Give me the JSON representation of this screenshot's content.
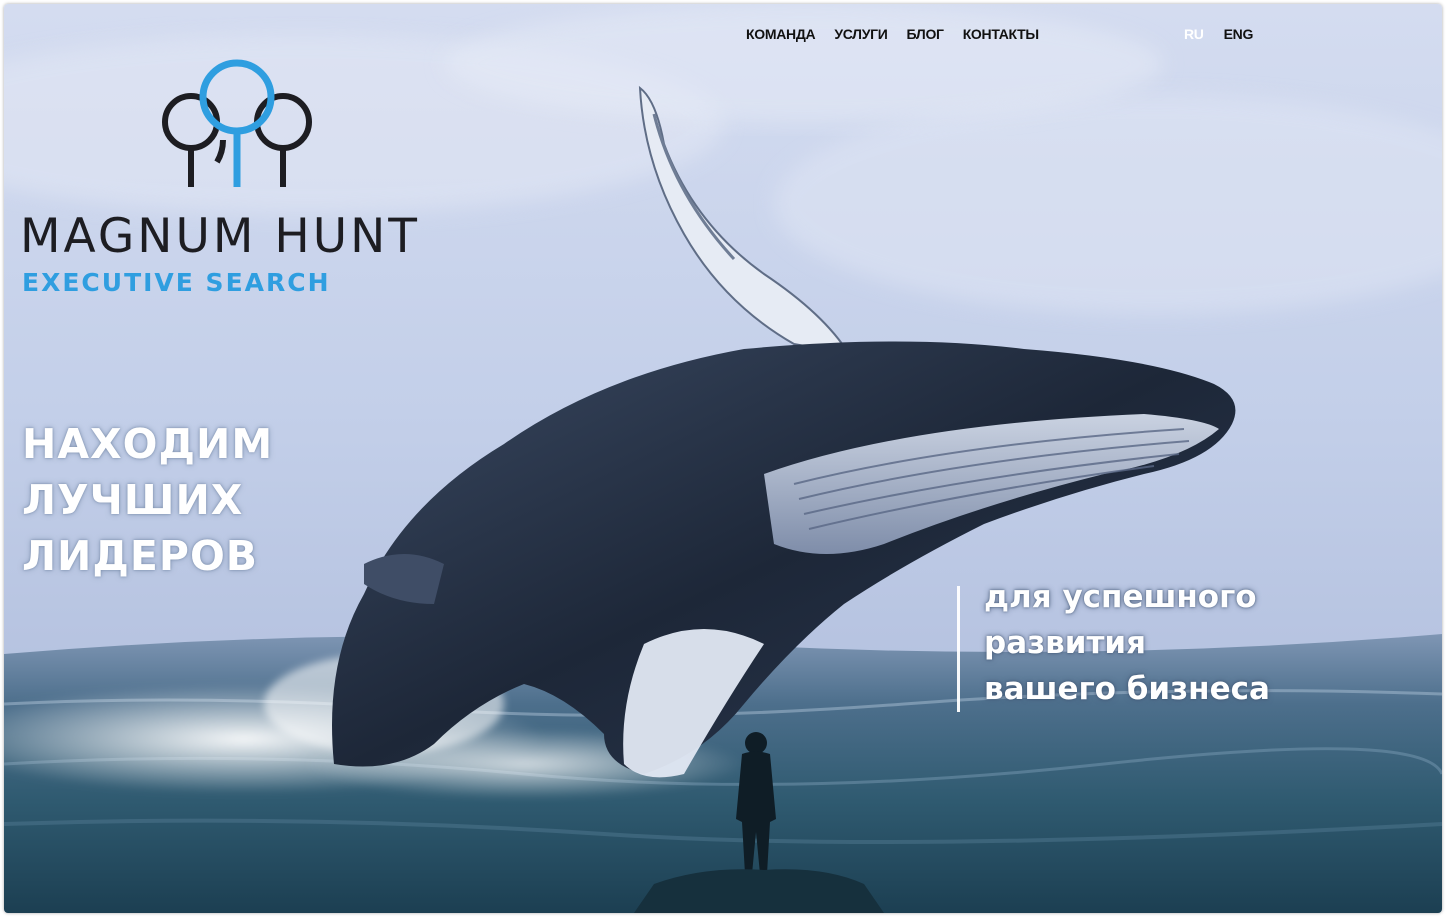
{
  "nav": {
    "items": [
      "КОМАНДА",
      "УСЛУГИ",
      "БЛОГ",
      "КОНТАКТЫ"
    ],
    "languages": [
      "RU",
      "ENG"
    ]
  },
  "brand": {
    "name": "MAGNUM HUNT",
    "subtitle": "EXECUTIVE SEARCH"
  },
  "hero": {
    "headline_lines": [
      "НАХОДИМ",
      "ЛУЧШИХ",
      "ЛИДЕРОВ"
    ],
    "tagline_lines": [
      "для успешного",
      "развития",
      "вашего бизнеса"
    ]
  },
  "colors": {
    "accent": "#2f9ee0",
    "text_dark": "#111111",
    "sky": "#c7d3ec",
    "sea": "#23445a"
  },
  "icons": {
    "logo": "three-trees-logo-icon"
  }
}
